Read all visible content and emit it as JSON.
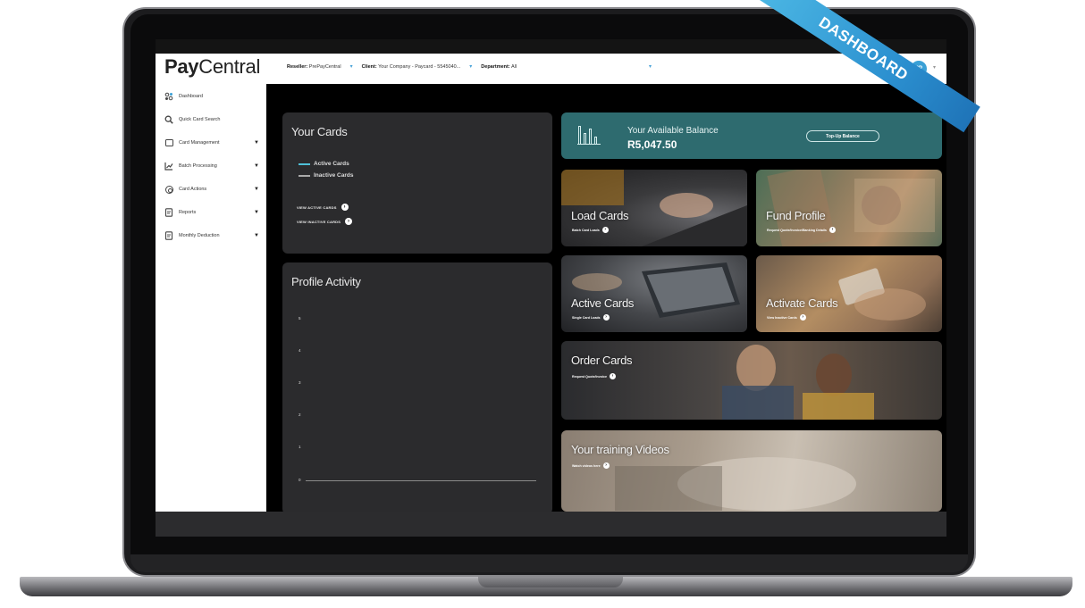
{
  "header": {
    "logo_bold": "Pay",
    "logo_light": "Central",
    "reseller_label": "Reseller:",
    "reseller_value": "PrePayCentral",
    "client_label": "Client:",
    "client_value": "Your Company - Paycard - 5545040...",
    "department_label": "Department:",
    "department_value": "All",
    "avatar_initials": "PP"
  },
  "sidebar": {
    "items": [
      {
        "label": "Dashboard",
        "icon": "dashboard-icon",
        "has_chevron": false
      },
      {
        "label": "Quick Card Search",
        "icon": "search-icon",
        "has_chevron": false
      },
      {
        "label": "Card Management",
        "icon": "card-icon",
        "has_chevron": true
      },
      {
        "label": "Batch Processing",
        "icon": "chart-icon",
        "has_chevron": true
      },
      {
        "label": "Card Actions",
        "icon": "target-icon",
        "has_chevron": true
      },
      {
        "label": "Reports",
        "icon": "document-icon",
        "has_chevron": true
      },
      {
        "label": "Monthly Deduction",
        "icon": "document-icon",
        "has_chevron": true
      }
    ]
  },
  "your_cards": {
    "title": "Your Cards",
    "legend": [
      {
        "label": "Active Cards",
        "color": "#4fc0d8"
      },
      {
        "label": "Inactive Cards",
        "color": "#aaaaaa"
      }
    ],
    "view_active": "VIEW ACTIVE CARDS",
    "view_inactive": "VIEW INACTIVE CARDS"
  },
  "profile_activity": {
    "title": "Profile Activity",
    "ticks": [
      "5",
      "4",
      "3",
      "2",
      "1",
      "0"
    ]
  },
  "balance": {
    "label": "Your Available Balance",
    "value": "R5,047.50",
    "topup_label": "Top-Up Balance"
  },
  "tiles": [
    {
      "title": "Load Cards",
      "sub": "Batch Card Loads"
    },
    {
      "title": "Fund Profile",
      "sub": "Request Quote/Invoice/Banking Details"
    },
    {
      "title": "Active Cards",
      "sub": "Single Card Loads"
    },
    {
      "title": "Activate Cards",
      "sub": "View Inactive Cards"
    },
    {
      "title": "Order Cards",
      "sub": "Request Quote/Invoice"
    },
    {
      "title": "Your training Videos",
      "sub": "Watch videos here"
    }
  ],
  "ribbon": {
    "text": "DASHBOARD"
  },
  "colors": {
    "accent": "#3aa0d6",
    "balance_bg": "#2e6b6f",
    "panel_bg": "#2b2b2d"
  }
}
